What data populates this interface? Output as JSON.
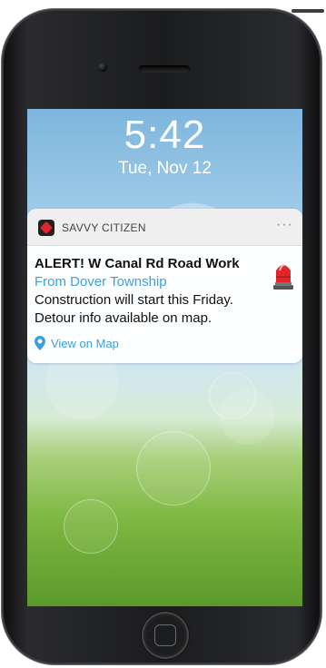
{
  "lockscreen": {
    "time": "5:42",
    "date": "Tue, Nov 12"
  },
  "notification": {
    "app_name": "SAVVY CITIZEN",
    "more_label": "···",
    "title": "ALERT! W Canal Rd Road Work",
    "source": "From Dover Township",
    "line1": "Construction will start this Friday.",
    "line2": "Detour info available on map.",
    "action_label": "View on Map",
    "icons": {
      "app": "savvy-citizen-app-icon",
      "alert": "siren-icon",
      "action": "map-pin-icon"
    },
    "colors": {
      "accent": "#3aa0de",
      "brand": "#e0262b",
      "header_bg": "#efefef"
    }
  }
}
